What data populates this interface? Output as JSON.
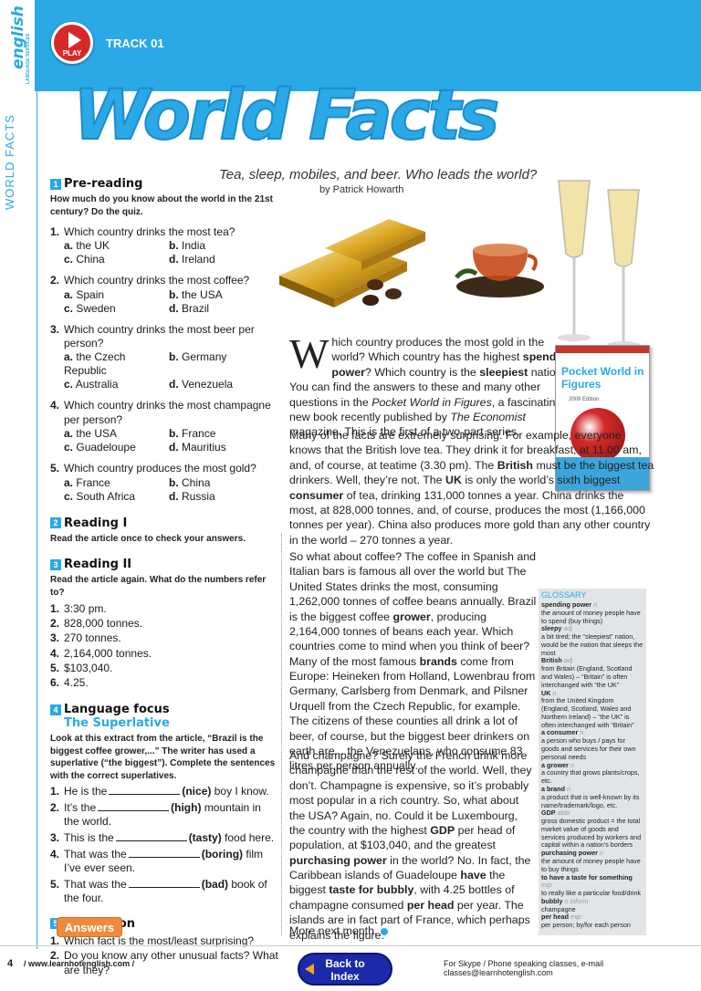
{
  "header": {
    "brand": "english",
    "brand_sub": "LANGUAGE SERVICES",
    "play_label": "PLAY",
    "track": "TRACK 01",
    "side_title": "WORLD FACTS"
  },
  "title": "World Facts",
  "subtitle": "Tea, sleep, mobiles, and beer. Who leads the world?",
  "byline": "by Patrick Howarth",
  "prereading": {
    "num": "1",
    "title": "Pre-reading",
    "instructions": "How much do you know about the world in the 21st century? Do the quiz.",
    "questions": [
      {
        "n": "1.",
        "text": "Which country drinks the most tea?",
        "a": "the UK",
        "b": "India",
        "c": "China",
        "d": "Ireland"
      },
      {
        "n": "2.",
        "text": "Which country drinks the most coffee?",
        "a": "Spain",
        "b": "the USA",
        "c": "Sweden",
        "d": "Brazil"
      },
      {
        "n": "3.",
        "text": "Which country drinks the most beer per person?",
        "a": "the Czech Republic",
        "b": "Germany",
        "c": "Australia",
        "d": "Venezuela"
      },
      {
        "n": "4.",
        "text": "Which country drinks the most champagne per person?",
        "a": "the USA",
        "b": "France",
        "c": "Guadeloupe",
        "d": "Mauritius"
      },
      {
        "n": "5.",
        "text": "Which country produces the most gold?",
        "a": "France",
        "b": "China",
        "c": "South Africa",
        "d": "Russia"
      }
    ],
    "letters": {
      "a": "a.",
      "b": "b.",
      "c": "c.",
      "d": "d."
    }
  },
  "reading1": {
    "num": "2",
    "title": "Reading I",
    "instructions": "Read the article once to check your answers."
  },
  "reading2": {
    "num": "3",
    "title": "Reading II",
    "instructions": "Read the article again. What do the numbers refer to?",
    "items": [
      {
        "n": "1.",
        "text": "3:30 pm."
      },
      {
        "n": "2.",
        "text": "828,000 tonnes."
      },
      {
        "n": "3.",
        "text": "270 tonnes."
      },
      {
        "n": "4.",
        "text": "2,164,000 tonnes."
      },
      {
        "n": "5.",
        "text": "$103,040."
      },
      {
        "n": "6.",
        "text": "4.25."
      }
    ]
  },
  "language_focus": {
    "num": "4",
    "title": "Language focus",
    "subtitle": "The Superlative",
    "instructions": "Look at this extract from the article, “Brazil is the biggest coffee grower,...” The writer has used a superlative (“the biggest”). Complete the sentences with the correct superlatives.",
    "sentences": [
      {
        "n": "1.",
        "before": "He is the",
        "word": "(nice)",
        "after": "boy I know."
      },
      {
        "n": "2.",
        "before": "It’s the",
        "word": "(high)",
        "after": "mountain in the world."
      },
      {
        "n": "3.",
        "before": "This is the",
        "word": "(tasty)",
        "after": "food here."
      },
      {
        "n": "4.",
        "before": "That was the",
        "word": "(boring)",
        "after": "film I’ve ever seen."
      },
      {
        "n": "5.",
        "before": "That was the",
        "word": "(bad)",
        "after": "book of the four."
      }
    ]
  },
  "discussion": {
    "num": "5",
    "title": "Discussion",
    "items": [
      {
        "n": "1.",
        "text": "Which fact is the most/least surprising?"
      },
      {
        "n": "2.",
        "text": "Do you know any other unusual facts? What are they?"
      }
    ]
  },
  "answers_button": "Answers",
  "article": {
    "p1_dropcap": "W",
    "p1_a": "hich country produces the most gold in the world? Which country has the highest ",
    "p1_b": "spending power",
    "p1_c": "? Which country is the ",
    "p1_d": "sleepiest",
    "p1_e": " nation? You can find the answers to these and many other questions in the ",
    "p1_f": "Pocket World in Figures",
    "p1_g": ", a fascinating new book recently published by ",
    "p1_h": "The Economist",
    "p1_i": " magazine. This is the first of a two-part series.",
    "p2_a": "Many of the facts are extremely surprising. For example, everyone knows that the British love tea. They drink it for breakfast, at 11.00 am, and, of course, at teatime (3.30 pm). The ",
    "p2_b": "British",
    "p2_c": " must be the biggest tea drinkers. Well, they’re not. The ",
    "p2_d": "UK",
    "p2_e": " is only the world’s sixth biggest ",
    "p2_f": "consumer",
    "p2_g": " of tea, drinking 131,000 tonnes a year. China drinks the most, at 828,000 tonnes, and, of course, produces the most (1,166,000 tonnes per year). China also produces more gold than any other country in the world – 270 tonnes a year.",
    "p3_a": "So what about coffee? The coffee in Spanish and Italian bars is famous all over the world but The United States drinks the most, consuming 1,262,000 tonnes of coffee beans annually. Brazil is the biggest coffee ",
    "p3_b": "grower",
    "p3_c": ", producing 2,164,000 tonnes of beans each year. Which countries come to mind when you think of beer? Many of the most famous ",
    "p3_d": "brands",
    "p3_e": " come from Europe: Heineken from Holland, Lowenbrau from Germany, Carlsberg from Denmark, and Pilsner Urquell from the Czech Republic, for example. The citizens of these counties all drink a lot of beer, of course, but the biggest beer drinkers on earth are... the Venezuelans, who consume 83 litres per person annually.",
    "p4_a": "And champagne? Surely the French drink more champagne than the rest of the world. Well, they don’t. Champagne is expensive, so it’s probably most popular in a rich country. So, what about the USA? Again, no. Could it be Luxembourg, the country with the highest ",
    "p4_b": "GDP",
    "p4_c": " per head of population, at $103,040, and the greatest ",
    "p4_d": "purchasing power",
    "p4_e": " in the world? No. In fact, the Caribbean islands of Guadeloupe ",
    "p4_f": "have",
    "p4_g": " the biggest ",
    "p4_h": "taste for bubbly",
    "p4_i": ", with 4.25 bottles of champagne consumed ",
    "p4_j": "per head",
    "p4_k": " per year. The islands are in fact part of France, which perhaps explains the figure.",
    "more": "More next month."
  },
  "book": {
    "title": "Pocket World in Figures",
    "edition": "2009 Edition"
  },
  "glossary": {
    "title": "GLOSSARY",
    "entries": [
      {
        "term": "spending power",
        "pos": "n",
        "def": "the amount of money people have to spend (buy things)"
      },
      {
        "term": "sleepy",
        "pos": "adj",
        "def": "a bit tired; the “sleepiest” nation, would be the nation that sleeps the most"
      },
      {
        "term": "British",
        "pos": "adj",
        "def": "from Britain (England, Scotland and Wales) – “Britain” is often interchanged with “the UK”"
      },
      {
        "term": "UK",
        "pos": "n",
        "def": "from the United Kingdom (England, Scotland, Wales and Northern Ireland) – “the UK” is often interchanged with “Britain”"
      },
      {
        "term": "a consumer",
        "pos": "n",
        "def": "a person who buys / pays for goods and services for their own personal needs"
      },
      {
        "term": "a grower",
        "pos": "n",
        "def": "a country that grows plants/crops, etc."
      },
      {
        "term": "a brand",
        "pos": "n",
        "def": "a product that is well-known by its name/trademark/logo, etc."
      },
      {
        "term": "GDP",
        "pos": "abbr",
        "def": "gross domestic product = the total market value of goods and services produced by workers and capital within a nation’s borders"
      },
      {
        "term": "purchasing power",
        "pos": "n",
        "def": "the amount of money people have to buy things"
      },
      {
        "term": "to have a taste for something",
        "pos": "exp",
        "def": "to really like a particular food/drink"
      },
      {
        "term": "bubbly",
        "pos": "n inform",
        "def": "champagne"
      },
      {
        "term": "per head",
        "pos": "exp",
        "def": "per person; by/for each person"
      }
    ]
  },
  "footer": {
    "page": "4",
    "site": "/ www.learnhotenglish.com /",
    "back_line1": "Back to",
    "back_line2": "Index",
    "skype": "For Skype / Phone speaking classes, e-mail classes@learnhotenglish.com"
  },
  "colors": {
    "accent": "#2aa9e6",
    "play": "#d42a2a",
    "answers": "#f08a3c",
    "back": "#1a2aa8"
  }
}
